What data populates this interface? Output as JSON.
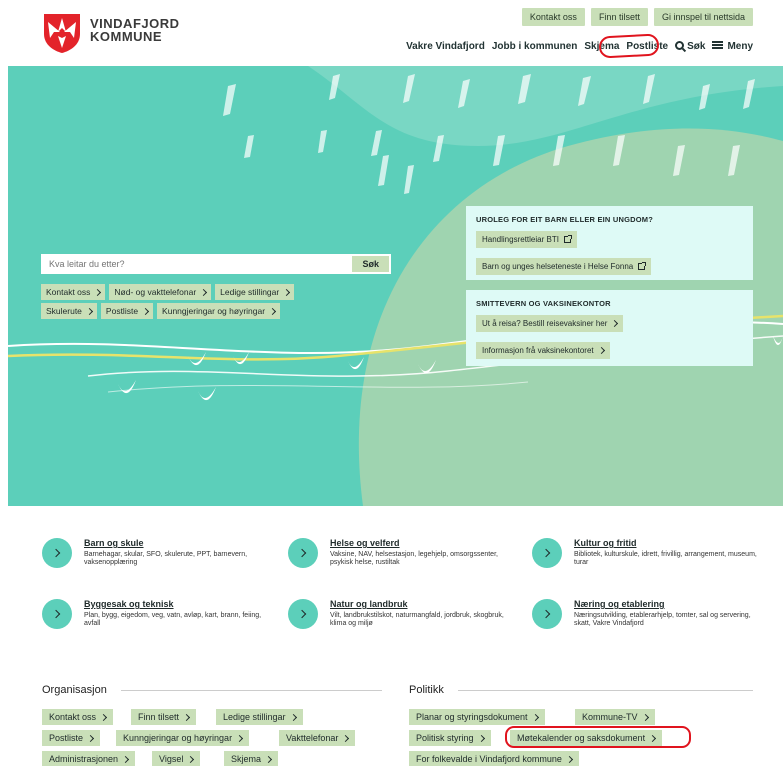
{
  "logo": {
    "line1": "VINDAFJORD",
    "line2": "KOMMUNE"
  },
  "top_buttons": [
    "Kontakt oss",
    "Finn tilsett",
    "Gi innspel til nettsida"
  ],
  "nav": {
    "items": [
      "Vakre Vindafjord",
      "Jobb i kommunen",
      "Skjema",
      "Postliste"
    ],
    "search_label": "Søk",
    "menu_label": "Meny"
  },
  "search": {
    "placeholder": "Kva leitar du etter?",
    "button": "Søk"
  },
  "quick_links_row1": [
    "Kontakt oss",
    "Nød- og vakttelefonar",
    "Ledige stillingar"
  ],
  "quick_links_row2": [
    "Skulerute",
    "Postliste",
    "Kunngjeringar og høyringar"
  ],
  "card1": {
    "title": "UROLEG FOR EIT BARN ELLER EIN UNGDOM?",
    "btn1": "Handlingsrettleiar BTI",
    "btn2": "Barn og unges helseteneste i Helse Fonna"
  },
  "card2": {
    "title": "SMITTEVERN OG VAKSINEKONTOR",
    "btn1": "Ut å reisa? Bestill reisevaksiner her",
    "btn2": "Informasjon frå vaksinekontoret"
  },
  "categories": [
    {
      "title": "Barn og skule",
      "desc": "Barnehagar, skular, SFO, skulerute, PPT, barnevern, vaksenopplæring"
    },
    {
      "title": "Helse og velferd",
      "desc": "Vaksine, NAV, helsestasjon, legehjelp, omsorgssenter, psykisk helse, rustiltak"
    },
    {
      "title": "Kultur og fritid",
      "desc": "Bibliotek, kulturskule, idrett, frivillig, arrangement, museum, turar"
    },
    {
      "title": "Byggesak og teknisk",
      "desc": "Plan, bygg, eigedom, veg, vatn, avløp, kart, brann, feiing, avfall"
    },
    {
      "title": "Natur og landbruk",
      "desc": "Vilt, landbrukstilskot, naturmangfald, jordbruk, skogbruk, klima og miljø"
    },
    {
      "title": "Næring og etablering",
      "desc": "Næringsutvikling, etablerarhjelp, tomter, sal og servering, skatt, Vakre Vindafjord"
    }
  ],
  "organisasjon": {
    "title": "Organisasjon",
    "links": [
      "Kontakt oss",
      "Finn tilsett",
      "Ledige stillingar",
      "Postliste",
      "Kunngjeringar og høyringar",
      "Vakttelefonar",
      "Administrasjonen",
      "Vigsel",
      "Skjema"
    ]
  },
  "politikk": {
    "title": "Politikk",
    "links": [
      "Planar og styringsdokument",
      "Kommune-TV",
      "Politisk styring",
      "Møtekalender og saksdokument",
      "For folkevalde i Vindafjord kommune"
    ]
  },
  "colors": {
    "teal": "#5ccfba",
    "pill": "#c9dfb8",
    "card": "#defaf6",
    "highlight": "#e0141e"
  }
}
